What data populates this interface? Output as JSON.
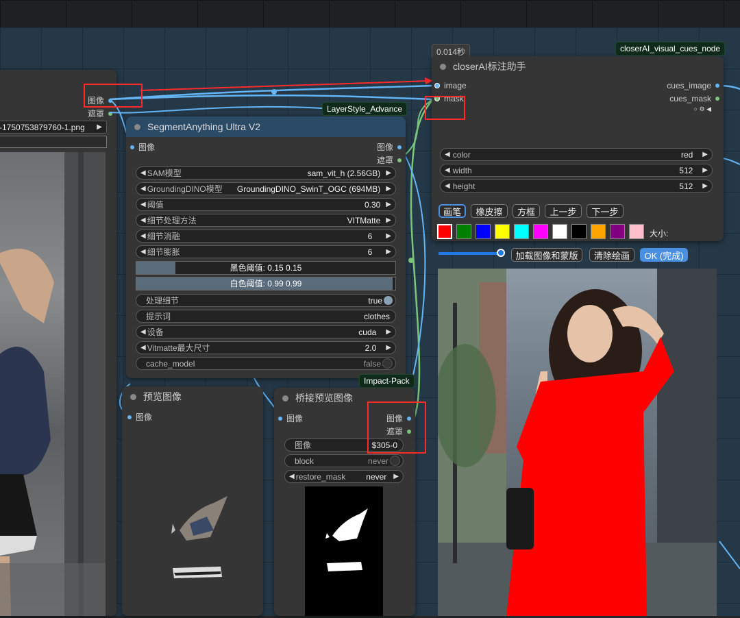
{
  "time_badge": "0.014秒",
  "tags": {
    "cues_node": "closerAI_visual_cues_node",
    "layerstyle": "LayerStyle_Advance",
    "impact": "Impact-Pack"
  },
  "left_node": {
    "out_image": "图像",
    "out_mask": "遮罩",
    "filename": "-1750753879760-1.png"
  },
  "segment": {
    "title": "SegmentAnything Ultra V2",
    "in_image": "图像",
    "out_image": "图像",
    "out_mask": "遮罩",
    "widgets": [
      {
        "label": "SAM模型",
        "value": "sam_vit_h (2.56GB)"
      },
      {
        "label": "GroundingDINO模型",
        "value": "GroundingDINO_SwinT_OGC (694MB)"
      },
      {
        "label": "阈值",
        "value": "0.30"
      },
      {
        "label": "细节处理方法",
        "value": "VITMatte"
      },
      {
        "label": "细节消融",
        "value": "6"
      },
      {
        "label": "细节膨胀",
        "value": "6"
      }
    ],
    "black_threshold": "黑色阈值: 0.15  0.15",
    "black_fill": 0.15,
    "white_threshold": "白色阈值: 0.99  0.99",
    "white_fill": 0.99,
    "process_detail": {
      "label": "处理细节",
      "value": "true"
    },
    "prompt": {
      "label": "提示词",
      "value": "clothes"
    },
    "device": {
      "label": "设备",
      "value": "cuda"
    },
    "vitmatte": {
      "label": "Vitmatte最大尺寸",
      "value": "2.0"
    },
    "cache": {
      "label": "cache_model",
      "value": "false"
    }
  },
  "cues": {
    "title": "closerAI标注助手",
    "in_image": "image",
    "in_mask": "mask",
    "out_image": "cues_image",
    "out_mask": "cues_mask",
    "color": {
      "label": "color",
      "value": "red"
    },
    "width": {
      "label": "width",
      "value": "512"
    },
    "height": {
      "label": "height",
      "value": "512"
    },
    "tools": [
      "画笔",
      "橡皮擦",
      "方框",
      "上一步",
      "下一步"
    ],
    "palette": [
      "#ff0000",
      "#008000",
      "#0000ff",
      "#ffff00",
      "#00ffff",
      "#ff00ff",
      "#ffffff",
      "#000000",
      "#ffa500",
      "#800080",
      "#ffc0cb"
    ],
    "size_label": "大小:",
    "slider_value": 0.95,
    "load_btn": "加载图像和蒙版",
    "clear_btn": "清除绘画",
    "ok_btn": "OK (完成)"
  },
  "preview": {
    "title": "预览图像",
    "in_image": "图像"
  },
  "bridge": {
    "title": "桥接预览图像",
    "in_image": "图像",
    "out_image": "图像",
    "out_mask": "遮罩",
    "image_widget": {
      "label": "图像",
      "value": "$305-0"
    },
    "block": {
      "label": "block",
      "value": "never"
    },
    "restore": {
      "label": "restore_mask",
      "value": "never"
    }
  },
  "colors": {
    "accent_blue": "#4a90e2",
    "wire_blue": "#64b5f6",
    "wire_green": "#7bc67b",
    "highlight_red": "#ff2b2b"
  }
}
